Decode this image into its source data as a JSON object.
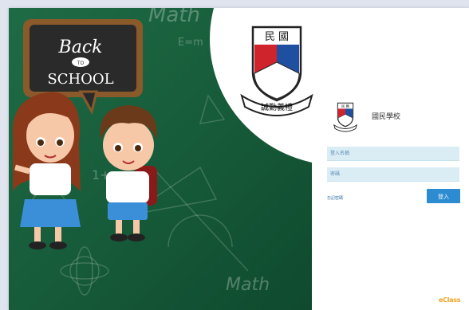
{
  "hero": {
    "chalkboard_line1": "Back",
    "chalkboard_line2": "TO",
    "chalkboard_line3": "SCHOOL",
    "formula_1": "Math",
    "formula_2": "E=m",
    "formula_3": "1+",
    "formula_4": "Math"
  },
  "school": {
    "emblem_top": "民 國",
    "emblem_motto": "誠勤義禮",
    "name": "國民學校"
  },
  "login": {
    "username_placeholder": "登入名稱",
    "password_placeholder": "密碼",
    "forgot_link": "忘記密碼",
    "submit_label": "登入"
  },
  "footer": {
    "brand": "eClass"
  },
  "colors": {
    "hero_green": "#1f6b46",
    "button_blue": "#2d8bd1",
    "field_bg": "#daedf5",
    "shield_red": "#d0242c",
    "shield_blue": "#1f4fa0"
  }
}
